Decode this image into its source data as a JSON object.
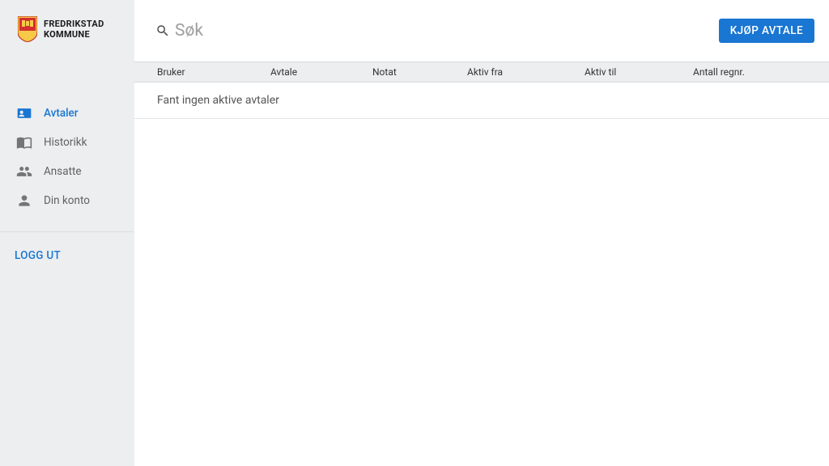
{
  "brand": {
    "line1": "FREDRIKSTAD",
    "line2": "KOMMUNE"
  },
  "sidebar": {
    "items": [
      {
        "label": "Avtaler"
      },
      {
        "label": "Historikk"
      },
      {
        "label": "Ansatte"
      },
      {
        "label": "Din konto"
      }
    ],
    "logout": "LOGG UT"
  },
  "header": {
    "search_placeholder": "Søk",
    "buy_button": "KJØP AVTALE"
  },
  "table": {
    "columns": {
      "bruker": "Bruker",
      "avtale": "Avtale",
      "notat": "Notat",
      "aktiv_fra": "Aktiv fra",
      "aktiv_til": "Aktiv til",
      "antall_regnr": "Antall regnr."
    },
    "empty_message": "Fant ingen aktive avtaler"
  }
}
